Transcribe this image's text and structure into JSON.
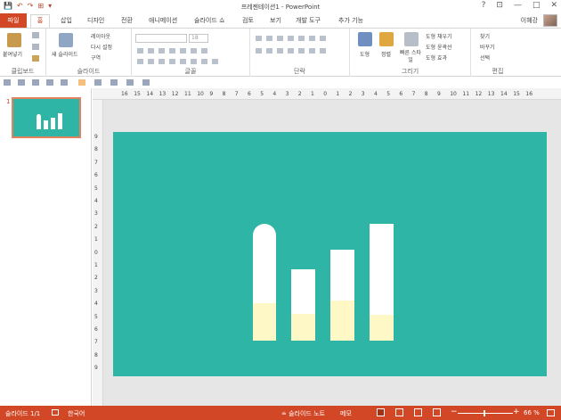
{
  "window": {
    "title": "프레젠테이션1 - PowerPoint",
    "controls": [
      "?",
      "⊡",
      "—",
      "□",
      "✕"
    ]
  },
  "quick_access": [
    "💾",
    "↶",
    "↷",
    "⊞",
    "▾"
  ],
  "tabs": [
    "파일",
    "홈",
    "삽입",
    "디자인",
    "전환",
    "애니메이션",
    "슬라이드 쇼",
    "검토",
    "보기",
    "개발 도구",
    "추가 기능"
  ],
  "user": "이혜강",
  "ribbon": {
    "clipboard": {
      "label": "클립보드",
      "paste": "붙여넣기"
    },
    "slides": {
      "label": "슬라이드",
      "new_slide": "새 슬라이드",
      "layout": "레이아웃",
      "reset": "다시 설정",
      "section": "구역"
    },
    "font": {
      "label": "글꼴",
      "font_name": "",
      "font_size": "18"
    },
    "paragraph": {
      "label": "단락"
    },
    "drawing": {
      "label": "그리기",
      "shapes": "도형",
      "arrange": "정렬",
      "quick_styles": "빠른 스타일",
      "fill": "도형 채우기",
      "outline": "도형 윤곽선",
      "effects": "도형 효과"
    },
    "editing": {
      "label": "편집",
      "find": "찾기",
      "replace": "바꾸기",
      "select": "선택"
    }
  },
  "ruler": {
    "h": [
      "16",
      "15",
      "14",
      "13",
      "12",
      "11",
      "10",
      "9",
      "8",
      "7",
      "6",
      "5",
      "4",
      "3",
      "2",
      "1",
      "0",
      "1",
      "2",
      "3",
      "4",
      "5",
      "6",
      "7",
      "8",
      "9",
      "10",
      "11",
      "12",
      "13",
      "14",
      "15",
      "16"
    ],
    "v": [
      "9",
      "8",
      "7",
      "6",
      "5",
      "4",
      "3",
      "2",
      "1",
      "0",
      "1",
      "2",
      "3",
      "4",
      "5",
      "6",
      "7",
      "8",
      "9"
    ]
  },
  "thumbnails": [
    {
      "number": "1"
    }
  ],
  "slide": {
    "background": "#2fb5a5",
    "bars": [
      {
        "name": "bar-1",
        "rounded": true,
        "fill_fraction": 0.32
      },
      {
        "name": "bar-2",
        "rounded": false,
        "fill_fraction": 0.37
      },
      {
        "name": "bar-3",
        "rounded": false,
        "fill_fraction": 0.44
      },
      {
        "name": "bar-4",
        "rounded": false,
        "fill_fraction": 0.22
      }
    ]
  },
  "status": {
    "slide_count": "슬라이드 1/1",
    "language": "한국어",
    "notes": "≐ 슬라이드 노트",
    "comments": "메모",
    "zoom": "66 %"
  },
  "colors": {
    "accent": "#d24726",
    "slide_bg": "#2fb5a5",
    "bar_fill": "#fef8c6"
  }
}
